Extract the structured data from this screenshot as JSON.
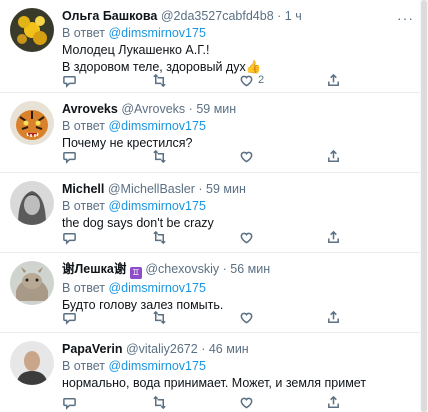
{
  "tweets": [
    {
      "name": "Ольга Башкова",
      "handle": "@2da3527cabfd4b8",
      "time": "1 ч",
      "reply_label": "В ответ",
      "reply_to": "@dimsmirnov175",
      "lines": [
        "Молодец Лукашенко А.Г.!",
        "В здоровом теле, здоровый дух👍"
      ],
      "like_count": "2"
    },
    {
      "name": "Avroveks",
      "handle": "@Avroveks",
      "time": "59 мин",
      "reply_label": "В ответ",
      "reply_to": "@dimsmirnov175",
      "lines": [
        "Почему не крестился?"
      ]
    },
    {
      "name": "Michell",
      "handle": "@MichellBasler",
      "time": "59 мин",
      "reply_label": "В ответ",
      "reply_to": "@dimsmirnov175",
      "lines": [
        "the dog says don't be crazy"
      ]
    },
    {
      "name": "谢Лешка谢",
      "name_badge": "♊",
      "handle": "@chexovskiy",
      "time": "56 мин",
      "reply_label": "В ответ",
      "reply_to": "@dimsmirnov175",
      "lines": [
        "Будто голову залез помыть."
      ]
    },
    {
      "name": "PapaVerin",
      "handle": "@vitaliy2672",
      "time": "46 мин",
      "reply_label": "В ответ",
      "reply_to": "@dimsmirnov175",
      "lines": [
        "нормально, вода принимает. Может, и земля примет"
      ]
    }
  ],
  "separator": "·",
  "more_icon": "···",
  "colors": {
    "accent": "#1b95e0",
    "muted": "#5b7083",
    "divider": "#e6ecf0"
  }
}
